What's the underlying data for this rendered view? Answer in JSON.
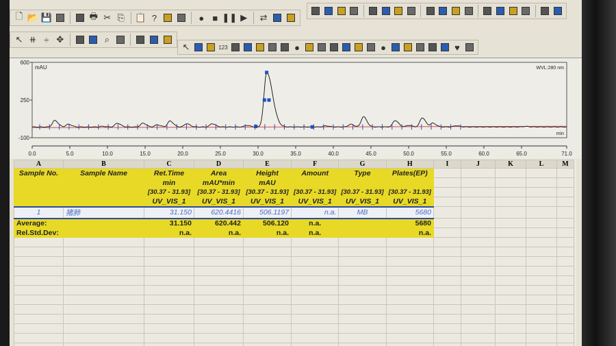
{
  "toolbar1": [
    "new-file",
    "open-folder",
    "save",
    "numbered-list",
    "report",
    "print",
    "cut",
    "copy",
    "paste",
    "help",
    "inject-drop",
    "syringe",
    "record",
    "stop",
    "pause",
    "play",
    "exchange",
    "sequence",
    "play-circle"
  ],
  "toolbar2": [
    "pointer",
    "baseline",
    "split",
    "move",
    "select-peak",
    "select-peak-red",
    "zoom",
    "delete-peak",
    "auto-integrate",
    "manual-integrate",
    "properties"
  ],
  "toolbar3": [
    "arrow",
    "text-box",
    "filled-box",
    "number",
    "bar",
    "frame",
    "chart-mini",
    "window",
    "monitor",
    "circle",
    "separator",
    "text",
    "book",
    "square",
    "square",
    "square",
    "circle-filled",
    "axis",
    "pin",
    "plot",
    "list",
    "table",
    "heart",
    "flag"
  ],
  "toolbar4": [
    "chromatogram",
    "peak-table",
    "grey-box",
    "spectrum",
    "calibration",
    "overlay",
    "window",
    "columns",
    "scan",
    "library",
    "grey",
    "trend",
    "grid",
    "grid2",
    "flask",
    "flask2",
    "tools",
    "tools2"
  ],
  "chart_data": {
    "type": "line",
    "ylabel": "mAU",
    "xlabel": "min",
    "annotation": "WVL:280 nm",
    "xlim": [
      0,
      71
    ],
    "ylim": [
      -100,
      600
    ],
    "xticks": [
      "0.0",
      "5.0",
      "10.0",
      "15.0",
      "20.0",
      "25.0",
      "30.0",
      "35.0",
      "40.0",
      "45.0",
      "50.0",
      "55.0",
      "60.0",
      "65.0",
      "71.0"
    ],
    "yticks": [
      "600",
      "250",
      "-100"
    ],
    "peaks": [
      [
        3.0,
        60
      ],
      [
        4.8,
        25
      ],
      [
        9.3,
        6
      ],
      [
        11.3,
        35
      ],
      [
        14.7,
        35
      ],
      [
        16.6,
        20
      ],
      [
        18.3,
        55
      ],
      [
        20.5,
        30
      ],
      [
        23.9,
        30
      ],
      [
        28.5,
        15
      ],
      [
        31.15,
        506
      ],
      [
        39.0,
        10
      ],
      [
        42.3,
        25
      ],
      [
        44.0,
        95
      ],
      [
        48.2,
        60
      ],
      [
        50.0,
        15
      ],
      [
        51.8,
        85
      ],
      [
        53.2,
        35
      ],
      [
        56.3,
        12
      ],
      [
        65.5,
        5
      ]
    ],
    "main_peak": {
      "rt": 31.15,
      "height": 506
    }
  },
  "table": {
    "col_letters": [
      "A",
      "B",
      "C",
      "D",
      "E",
      "F",
      "G",
      "H",
      "I",
      "J",
      "K",
      "L",
      "M"
    ],
    "headers": [
      "Sample No.",
      "Sample Name",
      "Ret.Time",
      "Area",
      "Height",
      "Amount",
      "Type",
      "Plates(EP)"
    ],
    "units": [
      "",
      "",
      "min",
      "mAU*min",
      "mAU",
      "",
      "",
      ""
    ],
    "range": "[30.37 - 31.93]",
    "channel": "UV_VIS_1",
    "row": {
      "no": "1",
      "name": "猪肺",
      "ret": "31.150",
      "area": "620.4416",
      "height": "506.1197",
      "amount": "n.a.",
      "type": "MB",
      "plates": "5680"
    },
    "average": {
      "label": "Average:",
      "ret": "31.150",
      "area": "620.442",
      "height": "506.120",
      "amount": "n.a.",
      "plates": "5680"
    },
    "rsd": {
      "label": "Rel.Std.Dev:",
      "ret": "n.a.",
      "area": "n.a.",
      "height": "n.a.",
      "amount": "n.a.",
      "plates": "n.a."
    }
  }
}
